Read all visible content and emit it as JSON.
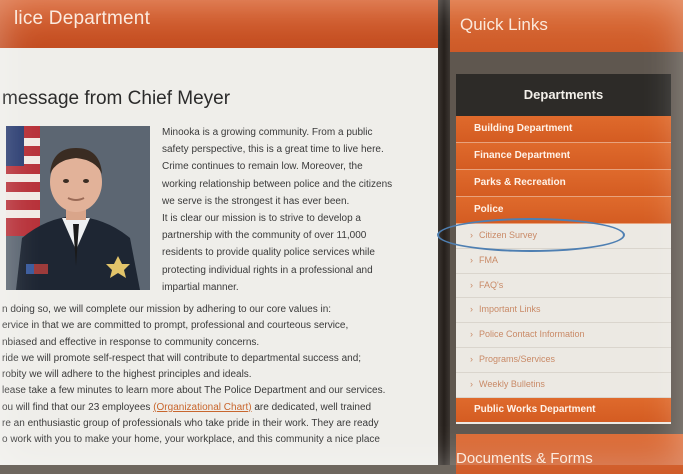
{
  "header": {
    "department_title": "lice Department"
  },
  "message": {
    "title": "message from Chief Meyer",
    "intro_lines": [
      "Minooka is a growing community. From a public",
      "safety perspective, this is a great time to live here.",
      "Crime continues to remain low. Moreover, the",
      "working relationship between police and the citizens",
      "we serve is the strongest it has ever been.",
      "It is clear our mission is to strive to develop a",
      "partnership with the community of over 11,000",
      "residents to provide quality police services while",
      "protecting individual rights in a professional and",
      "impartial manner."
    ],
    "body_lines": [
      "n doing so, we will complete our mission by adhering to our core values in:",
      "ervice in that we are committed to prompt, professional and courteous service,",
      "nbiased and effective in response to community concerns.",
      "ride we will promote self-respect that will contribute to departmental success and;",
      "robity we will adhere to the highest principles and ideals.",
      "lease take a few minutes to learn more about The Police Department and our services.",
      "ou will find that our 23 employees",
      "re an enthusiastic group of professionals who take pride in their work. They are ready",
      "o work with you to make your home, your workplace, and this community a nice place"
    ],
    "org_chart_link": "(Organizational Chart)",
    "org_chart_suffix": " are dedicated, well trained"
  },
  "sidebar": {
    "quick_links_title": "Quick Links",
    "departments_title": "Departments",
    "departments": [
      "Building Department",
      "Finance Department",
      "Parks & Recreation",
      "Police"
    ],
    "police_subitems": [
      "Citizen Survey",
      "FMA",
      "FAQ's",
      "Important Links",
      "Police Contact Information",
      "Programs/Services",
      "Weekly Bulletins"
    ],
    "public_works": "Public Works Department",
    "documents_title": "Documents & Forms"
  },
  "colors": {
    "orange": "#d45c22",
    "dark_header": "#2d2b28",
    "highlight_ring": "#4e7fb2"
  }
}
